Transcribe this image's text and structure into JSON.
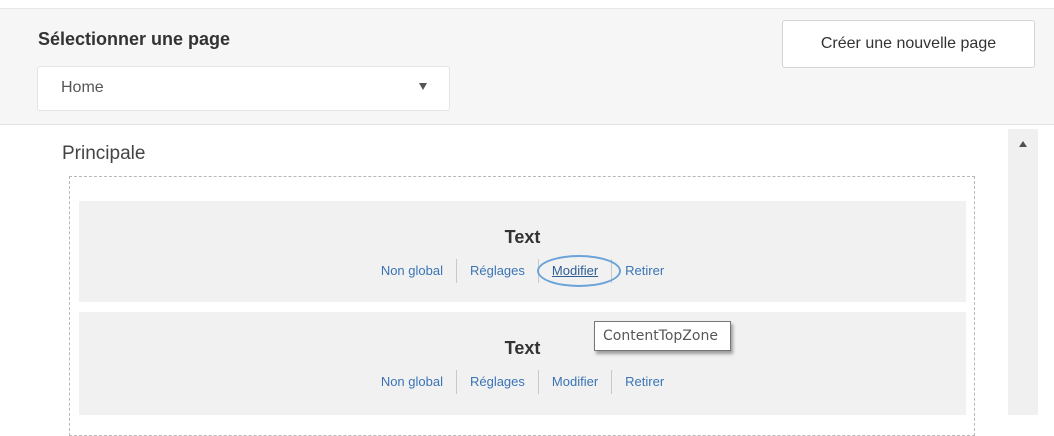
{
  "header": {
    "select_title": "Sélectionner une page",
    "selected_page": "Home",
    "create_button_label": "Créer une nouvelle page"
  },
  "zone": {
    "title": "Principale"
  },
  "widgets": [
    {
      "title": "Text",
      "actions": [
        "Non global",
        "Réglages",
        "Modifier",
        "Retirer"
      ]
    },
    {
      "title": "Text",
      "actions": [
        "Non global",
        "Réglages",
        "Modifier",
        "Retirer"
      ]
    }
  ],
  "tooltip": {
    "text": "ContentTopZone"
  },
  "icons": {
    "select_chevron": "chevron-down-icon",
    "scroll_up": "arrow-up-icon"
  },
  "colors": {
    "link": "#3a74b5",
    "highlight_circle": "#6aa3d9",
    "header_bg": "#f6f6f6",
    "widget_bg": "#f1f1f1"
  }
}
